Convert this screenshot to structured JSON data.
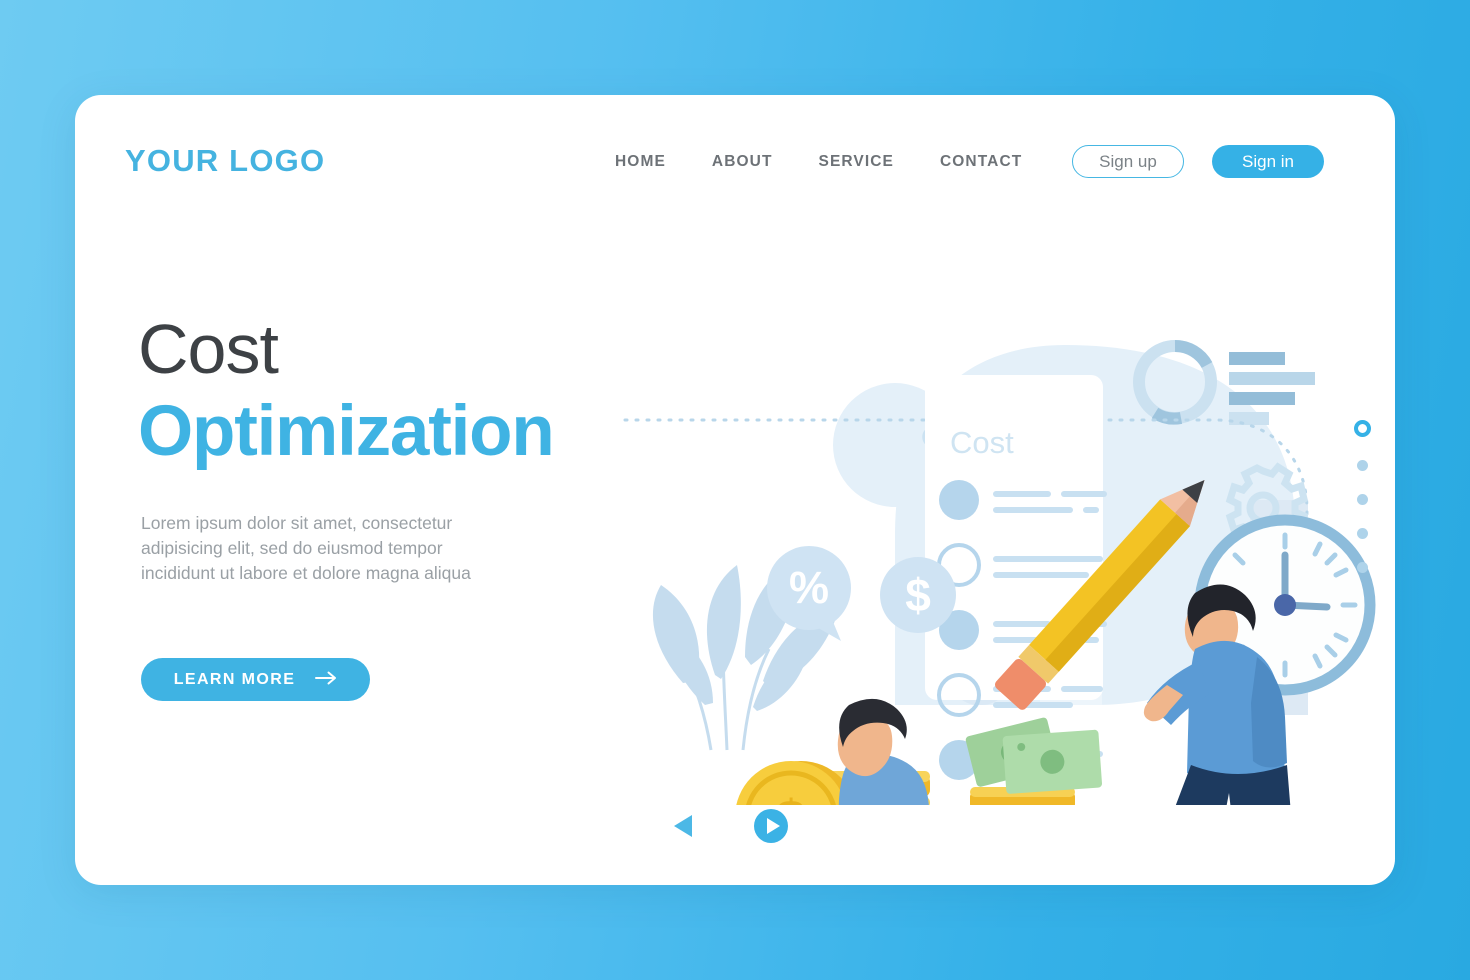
{
  "page": {
    "title": "Cost Optimization landing page"
  },
  "header": {
    "logo": "YOUR LOGO",
    "nav": [
      {
        "label": "HOME"
      },
      {
        "label": "ABOUT"
      },
      {
        "label": "SERVICE"
      },
      {
        "label": "CONTACT"
      }
    ],
    "sign_up": "Sign up",
    "sign_in": "Sign in"
  },
  "hero": {
    "heading_line1": "Cost",
    "heading_line2": "Optimization",
    "paragraph": "Lorem ipsum dolor sit amet, consectetur adipisicing elit, sed do eiusmod tempor incididunt ut labore et dolore magna aliqua",
    "cta_label": "LEARN MORE",
    "cta_icon": "arrow-right-icon"
  },
  "illustration": {
    "document_title": "Cost",
    "badge_percent": "%",
    "badge_dollar": "$",
    "coin_symbol": "$",
    "objects": [
      "checklist-document",
      "pencil",
      "wall-clock",
      "gear-icon",
      "donut-chart",
      "bar-chart",
      "coin-stack",
      "banknotes",
      "plant-leaves",
      "man-with-pencil",
      "man-with-laptop"
    ]
  },
  "carousel": {
    "prev_icon": "triangle-left-icon",
    "next_icon": "play-circle-icon",
    "dots": [
      {
        "active": true
      },
      {
        "active": false
      },
      {
        "active": false
      },
      {
        "active": false
      },
      {
        "active": false
      }
    ]
  },
  "colors": {
    "brand_blue": "#3fb3e3",
    "bg_blue_light": "#6ecbf2",
    "bg_blue_dark": "#29a9e1",
    "heading_dark": "#3d4145",
    "body_gray": "#9aa0a5",
    "nav_gray": "#6d7277",
    "illo_pale": "#e4f0f9",
    "illo_blue": "#a9cfe8",
    "coin_gold": "#f2c12e",
    "money_green": "#8fc98a",
    "shirt_blue": "#5b9bd5",
    "pants_navy": "#1f3864",
    "pencil_yellow": "#f5c029"
  }
}
